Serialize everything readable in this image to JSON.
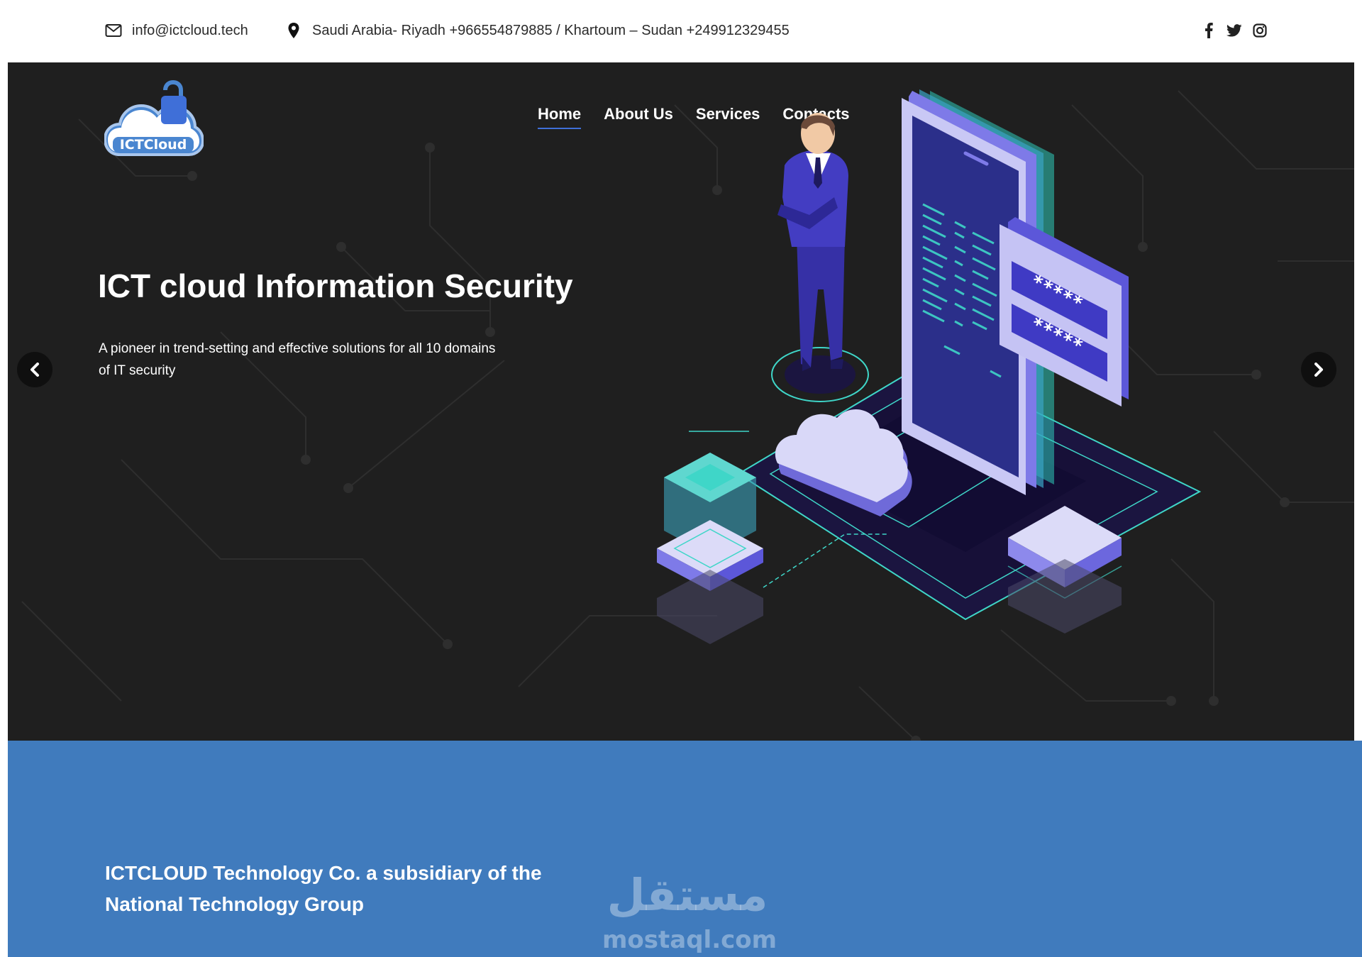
{
  "topbar": {
    "email": "info@ictcloud.tech",
    "address": "Saudi Arabia- Riyadh +966554879885 / Khartoum – Sudan +249912329455",
    "social": [
      "facebook-icon",
      "twitter-icon",
      "instagram-icon"
    ]
  },
  "logo": {
    "text": "ICTCloud"
  },
  "nav": {
    "items": [
      {
        "label": "Home",
        "active": true
      },
      {
        "label": "About Us"
      },
      {
        "label": "Services"
      },
      {
        "label": "Contacts"
      }
    ]
  },
  "hero": {
    "title": "ICT cloud Information Security",
    "subtitle": "A pioneer in trend-setting and effective solutions for all 10 domains of IT security",
    "password_mask_1": "*****",
    "password_mask_2": "*****"
  },
  "about": {
    "text": "ICTCLOUD Technology Co. a subsidiary of the National Technology Group"
  },
  "watermark": {
    "arabic": "مستقل",
    "latin": "mostaql.com"
  },
  "colors": {
    "hero_bg": "#1f1f1f",
    "blue_section": "#407bbd",
    "accent": "#3f6fd8",
    "teal": "#3fd6c8",
    "purple": "#5c57d9"
  }
}
